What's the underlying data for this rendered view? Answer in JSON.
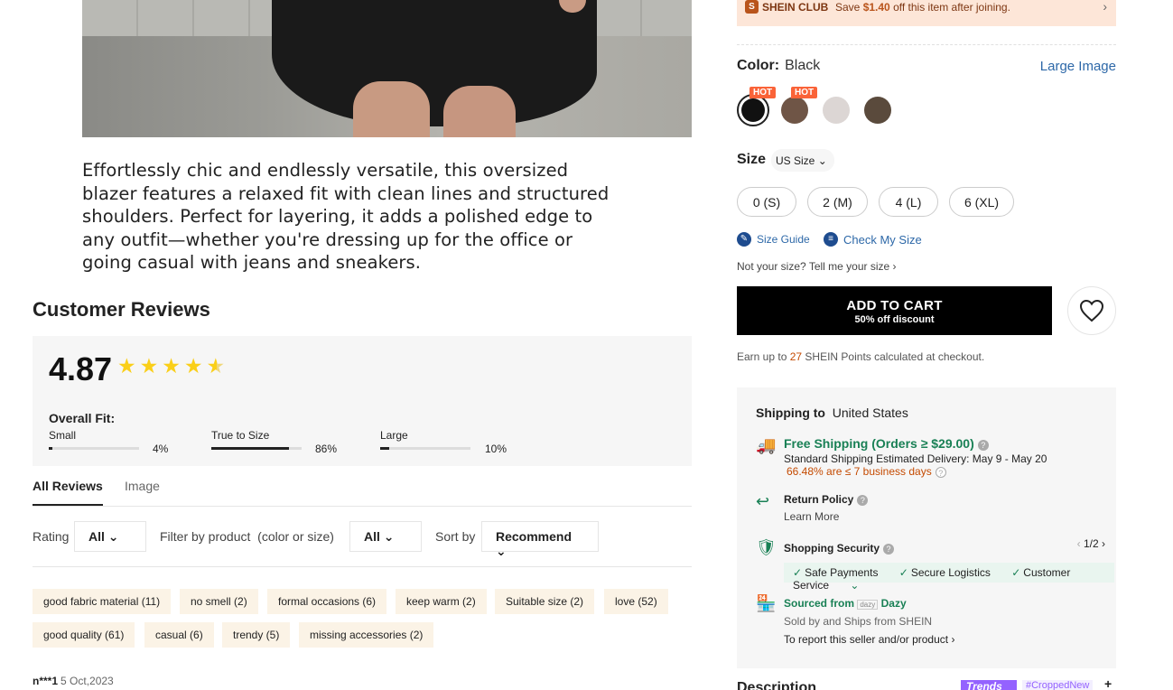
{
  "product": {
    "description": "Effortlessly chic and endlessly versatile, this oversized blazer features a relaxed fit with clean lines and structured shoulders. Perfect for layering, it adds a polished edge to any outfit—whether you're dressing up for the office or going casual with jeans and sneakers."
  },
  "reviews": {
    "title": "Customer Reviews",
    "score": "4.87",
    "stars": 4.87,
    "overall_fit_label": "Overall Fit:",
    "fit": [
      {
        "label": "Small",
        "percent": "4%",
        "fraction": 0.04
      },
      {
        "label": "True to Size",
        "percent": "86%",
        "fraction": 0.86
      },
      {
        "label": "Large",
        "percent": "10%",
        "fraction": 0.1
      }
    ],
    "tabs": [
      "All Reviews",
      "Image"
    ],
    "active_tab": "All Reviews",
    "filters": {
      "rating_label": "Rating",
      "rating_value": "All",
      "product_label": "Filter by product",
      "product_hint": "(color or size)",
      "product_value": "All",
      "sort_label": "Sort by",
      "sort_value": "Recommend"
    },
    "tags": [
      "good fabric material (11)",
      "no smell (2)",
      "formal occasions (6)",
      "keep warm (2)",
      "Suitable size (2)",
      "love (52)",
      "good quality (61)",
      "casual (6)",
      "trendy (5)",
      "missing accessories (2)"
    ],
    "first_review": {
      "user": "n***1",
      "date": "5 Oct,2023"
    }
  },
  "club": {
    "name": "SHEIN CLUB",
    "text_prefix": "Save",
    "amount": "$1.40",
    "text_suffix": "off this item after joining.",
    "accent_color": "#b9541b"
  },
  "color": {
    "label": "Color:",
    "value": "Black",
    "large_image": "Large Image",
    "hot_badge": "HOT",
    "swatches": [
      {
        "name": "Black",
        "hex": "#111111",
        "hot": true,
        "selected": true
      },
      {
        "name": "Brown",
        "hex": "#6f5546",
        "hot": true,
        "selected": false
      },
      {
        "name": "Light Gray",
        "hex": "#dcd6d4",
        "hot": false,
        "selected": false
      },
      {
        "name": "Dark Brown",
        "hex": "#5a4a3c",
        "hot": false,
        "selected": false
      }
    ]
  },
  "size": {
    "label": "Size",
    "system": "US Size",
    "options": [
      "0 (S)",
      "2 (M)",
      "4 (L)",
      "6 (XL)"
    ],
    "size_guide": "Size Guide",
    "check_size": "Check My Size",
    "not_your_size": "Not your size? Tell me your size"
  },
  "cart": {
    "label": "ADD TO CART",
    "sub": "50% off discount"
  },
  "points": {
    "prefix": "Earn up to",
    "value": "27",
    "suffix": "SHEIN Points calculated at checkout."
  },
  "shipping": {
    "label": "Shipping to",
    "country": "United States",
    "free_shipping": "Free Shipping (Orders ≥ $29.00)",
    "standard": "Standard Shipping Estimated Delivery: May 9 - May 20",
    "ontime_pct": "66.48% are ≤ 7",
    "ontime_suffix": "business days",
    "return_policy": "Return Policy",
    "learn_more": "Learn More",
    "security": "Shopping Security",
    "pager": "1/2",
    "security_items": [
      "Safe Payments",
      "Secure Logistics",
      "Customer Service"
    ],
    "sourced_from": "Sourced from",
    "brand": "Dazy",
    "sold_by": "Sold by and Ships from SHEIN",
    "report": "To report this seller and/or product",
    "green": "#198055"
  },
  "description_section": {
    "title": "Description",
    "trends_badge": "Trends",
    "trend_tag": "#CroppedNew"
  }
}
